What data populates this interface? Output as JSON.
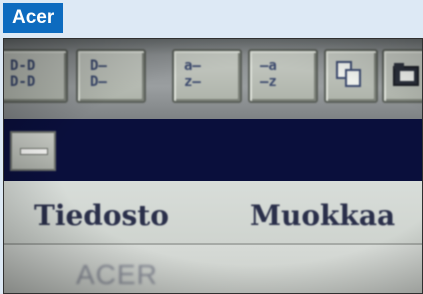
{
  "brand_tag": {
    "label": "Acer",
    "color": "#0d6bbf"
  },
  "screen": {
    "toolbar": {
      "buttons": [
        {
          "icon": "tree-view-icon",
          "glyph_top": "D-D",
          "glyph_bottom": "D-D"
        },
        {
          "icon": "list-view-icon",
          "glyph_top": "D—",
          "glyph_bottom": "D—"
        },
        {
          "icon": "sort-ascending-icon",
          "glyph_top": "a—",
          "glyph_bottom": "z—"
        },
        {
          "icon": "sort-descending-icon",
          "glyph_top": "—a",
          "glyph_bottom": "—z"
        },
        {
          "icon": "copy-files-icon",
          "glyph_top": "",
          "glyph_bottom": ""
        },
        {
          "icon": "folder-icon",
          "glyph_top": "",
          "glyph_bottom": ""
        }
      ]
    },
    "titlebar": {
      "color": "#0a0f3c"
    },
    "menubar": {
      "items": [
        "Tiedosto",
        "Muokkaa"
      ]
    },
    "content": {
      "text": "ACER"
    }
  }
}
